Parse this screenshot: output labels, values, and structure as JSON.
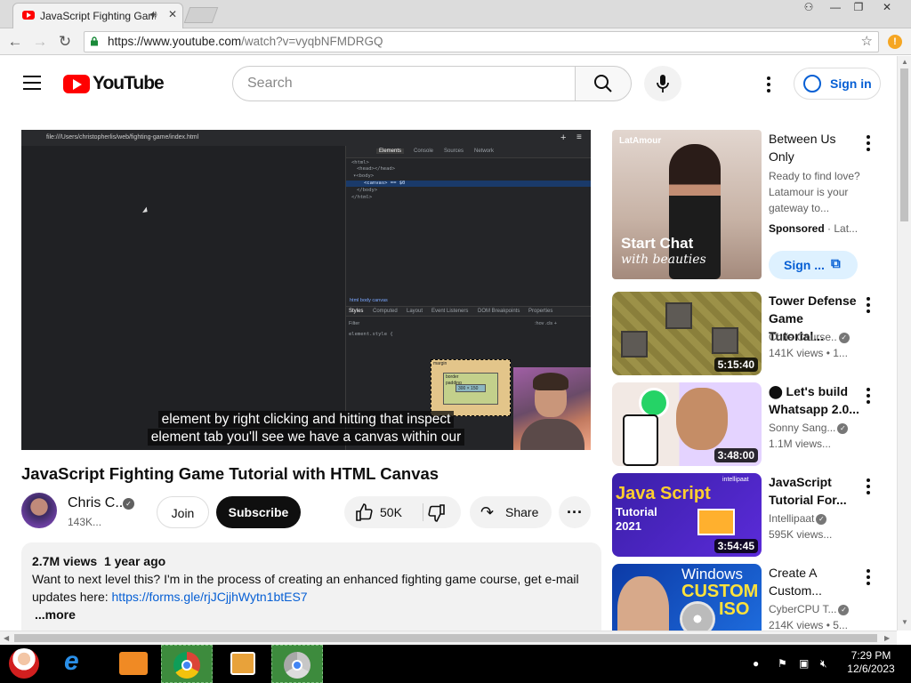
{
  "browser": {
    "tab_title": "JavaScript Fighting Game",
    "url_host": "https://www.youtube.com",
    "url_path": "/watch?v=vyqbNFMDRGQ",
    "win_buttons": [
      "⚇",
      "—",
      "❐",
      "✕"
    ],
    "nav_icons": [
      "back-arrow",
      "forward-arrow",
      "reload"
    ],
    "ext_badge": "!"
  },
  "header": {
    "logo_text": "YouTube",
    "search_placeholder": "Search",
    "signin_label": "Sign in"
  },
  "video": {
    "devtools_url": "file:///Users/christopherlis/web/fighting-game/index.html",
    "devtools_tabs": [
      "Elements",
      "Console",
      "Sources",
      "Network"
    ],
    "devtools_lines": [
      "<html>",
      "<head></head>",
      "▾<body>",
      "<canvas> == $0",
      "</body>",
      "</html>"
    ],
    "styles_tabs": [
      "Styles",
      "Computed",
      "Layout",
      "Event Listeners",
      "DOM Breakpoints",
      "Properties"
    ],
    "breadcrumb": "html  body  canvas",
    "filter_text": "Filter",
    "filter_right": ":hov  .cls  +",
    "style_rule": "element.style {",
    "box_labels": [
      "margin",
      "border",
      "padding",
      "300 × 150"
    ],
    "caption_line1": "element by right clicking and hitting that inspect",
    "caption_line2": "element tab you'll see we have a canvas within our"
  },
  "meta": {
    "title": "JavaScript Fighting Game Tutorial with HTML Canvas",
    "channel_name": "Chris C..",
    "subscribers": "143K...",
    "join_label": "Join",
    "subscribe_label": "Subscribe",
    "likes": "50K",
    "share_label": "Share"
  },
  "description": {
    "views": "2.7M views",
    "age": "1 year ago",
    "text": "Want to next level this? I'm in the process of creating an enhanced fighting game course, get e-mail updates here: ",
    "link": "https://forms.gle/rjJCjjhWytn1btES7",
    "more": "...more"
  },
  "sidebar": {
    "ad": {
      "brand": "LatAmour",
      "thumb_line1": "Start Chat",
      "thumb_line2": "with beauties",
      "title": "Between Us Only",
      "text": "Ready to find love? Latamour is your gateway to...",
      "sponsored": "Sponsored",
      "advertiser": "Lat...",
      "cta": "Sign ..."
    },
    "videos": [
      {
        "title": "Tower Defense Game Tutorial...",
        "channel": "Chris Course..",
        "views": "141K views",
        "age": "1...",
        "duration": "5:15:40"
      },
      {
        "title": "⬤ Let's build Whatsapp 2.0...",
        "channel": "Sonny Sang...",
        "views": "1.1M views...",
        "age": "",
        "duration": "3:48:00"
      },
      {
        "title": "JavaScript Tutorial For...",
        "channel": "Intellipaat",
        "views": "595K views...",
        "age": "",
        "duration": "3:54:45",
        "thumb_line1": "Java Script",
        "thumb_line2": "Tutorial",
        "thumb_line3": "2021",
        "thumb_brand": "intellipaat"
      },
      {
        "title": "Create A Custom...",
        "channel": "CyberCPU T...",
        "views": "214K views",
        "age": "5...",
        "duration": "",
        "thumb_line1": "Windows",
        "thumb_line2": "CUSTOM",
        "thumb_line3": "ISO"
      }
    ]
  },
  "taskbar": {
    "time": "7:29 PM",
    "date": "12/6/2023"
  },
  "colors": {
    "brand_red": "#ff0000",
    "link_blue": "#065fd4",
    "taskbar_active": "#3d8b3d"
  }
}
